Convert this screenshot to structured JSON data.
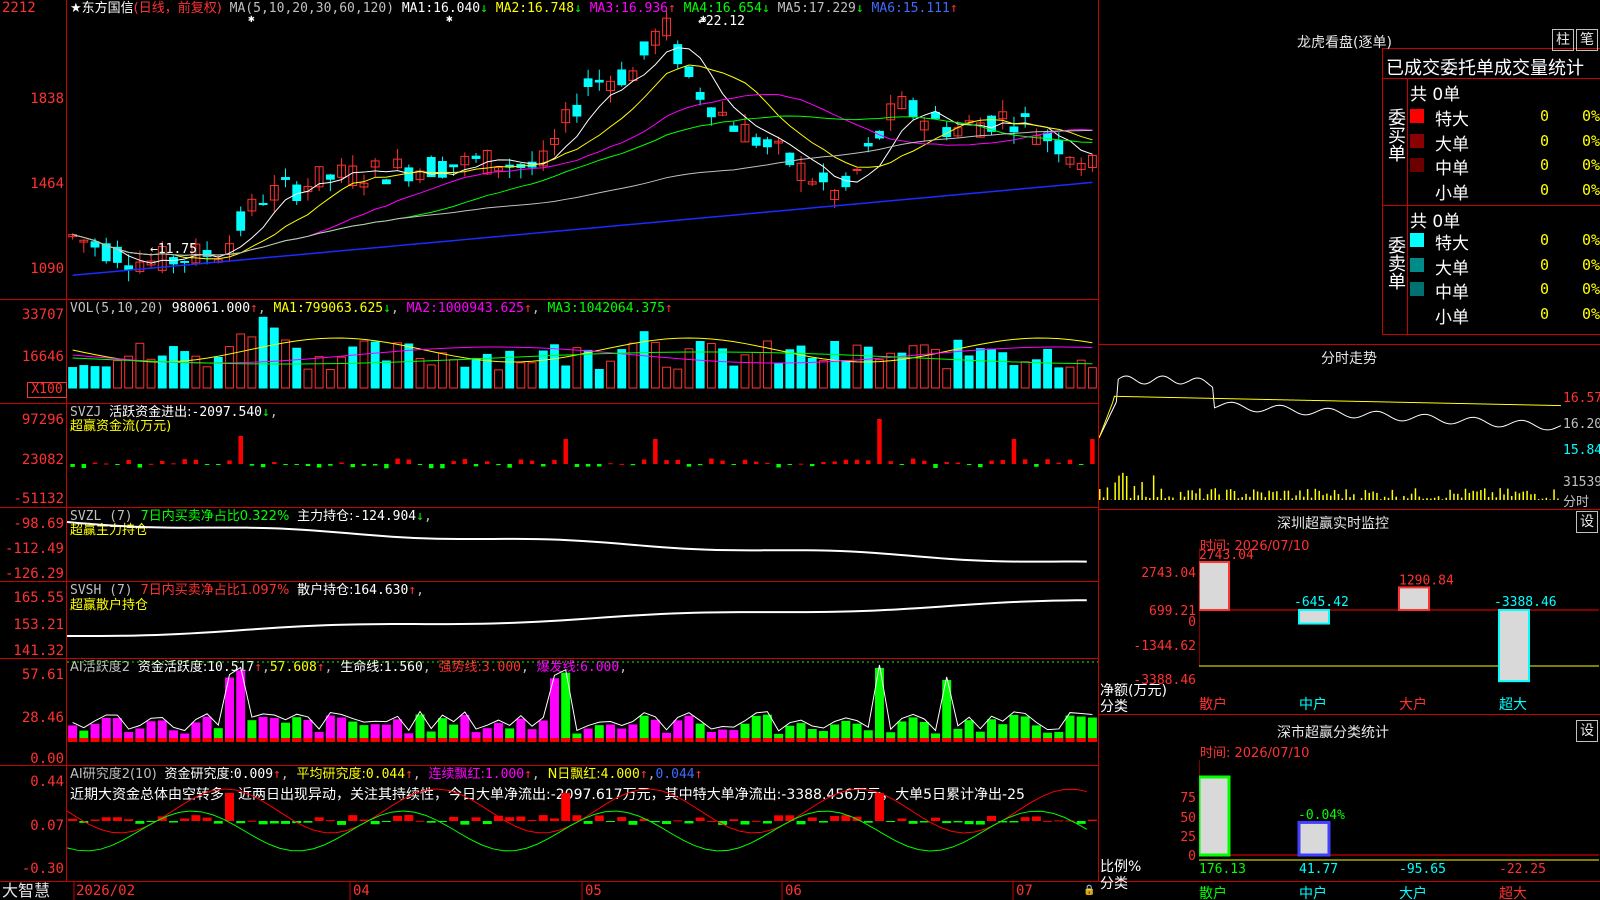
{
  "colors": {
    "up": "#ff3232",
    "down": "#00ffff",
    "bg": "#000000",
    "frame": "#c80000",
    "ma1": "#ffffff",
    "ma2": "#ffff00",
    "ma3": "#ff00ff",
    "ma4": "#00ff00",
    "ma5": "#c0c0c0",
    "ma6": "#1a2cff"
  },
  "brand": "大智慧",
  "main_chart": {
    "stock_name": "东方国信",
    "mode": "(日线，前复权)",
    "ma_label": "MA(5,10,20,30,60,120)",
    "ma1_label": "MA1:",
    "ma1_value": "16.040",
    "ma1_arrow": "↓",
    "ma2_label": "MA2:",
    "ma2_value": "16.748",
    "ma2_arrow": "↓",
    "ma3_label": "MA3:",
    "ma3_value": "16.936",
    "ma3_arrow": "↑",
    "ma4_label": "MA4:",
    "ma4_value": "16.654",
    "ma4_arrow": "↓",
    "ma5_label": "MA5:",
    "ma5_value": "17.229",
    "ma5_arrow": "↓",
    "ma6_label": "MA6:",
    "ma6_value": "15.111",
    "ma6_arrow": "↑",
    "y_ticks": [
      "2212",
      "1838",
      "1464",
      "1090"
    ],
    "high_mark": "22.12",
    "low_mark": "11.75",
    "x_labels": [
      "2026/02",
      "04",
      "05",
      "06",
      "07"
    ]
  },
  "vol": {
    "title": "VOL(5,10,20)",
    "value": "980061.000",
    "arrow": "↑",
    "ma1_label": "MA1:",
    "ma1_value": "799063.625",
    "ma1_arrow": "↓",
    "ma2_label": "MA2:",
    "ma2_value": "1000943.625",
    "ma2_arrow": "↑",
    "ma3_label": "MA3:",
    "ma3_value": "1042064.375",
    "ma3_arrow": "↑",
    "y_ticks": [
      "33707",
      "16646"
    ],
    "unit": "X100"
  },
  "svzj": {
    "title": "SVZJ",
    "label": "活跃资金进出:",
    "value": "-2097.540",
    "arrow": "↓",
    "sep": ",",
    "subtitle": "超赢资金流(万元)",
    "y_ticks": [
      "97296",
      "23082",
      "-51132"
    ]
  },
  "svzl": {
    "title": "SVZL (7)",
    "metric": "7日内买卖净占比0.322%",
    "label": "主力持仓:",
    "value": "-124.904",
    "arrow": "↓",
    "sep": ",",
    "subtitle": "超赢主力持仓",
    "y_ticks": [
      "-98.69",
      "-112.49",
      "-126.29"
    ]
  },
  "svsh": {
    "title": "SVSH (7)",
    "metric": "7日内买卖净占比1.097%",
    "label": "散户持仓:",
    "value": "164.630",
    "arrow": "↑",
    "sep": ",",
    "subtitle": "超赢散户持仓",
    "y_ticks": [
      "165.55",
      "153.21",
      "141.32"
    ]
  },
  "ai_active": {
    "title": "AI活跃度2",
    "label": "资金活跃度:",
    "value": "10.517",
    "arrow": "↑",
    "v2": "57.608",
    "v2_arrow": "↑",
    "life_label": "生命线:",
    "life_value": "1.560",
    "strong_label": "强势线:",
    "strong_value": "3.000",
    "burst_label": "爆发线:",
    "burst_value": "6.000",
    "y_ticks": [
      "57.61",
      "28.46",
      "0.00"
    ]
  },
  "ai_research": {
    "title": "AI研究度2(10)",
    "label": "资金研究度:",
    "value": "0.009",
    "arrow": "↑",
    "avg_label": "平均研究度:",
    "avg_value": "0.044",
    "avg_arrow": "↑",
    "cont_label": "连续飘红:",
    "cont_value": "1.000",
    "cont_arrow": "↑",
    "n_label": "N日飘红:",
    "n_value": "4.000",
    "n_arrow": "↑",
    "last_value": "0.044",
    "last_arrow": "↑",
    "comment": "近期大资金总体由空转多，近两日出现异动，关注其持续性，今日大单净流出:-2097.617万元，其中特大单净流出:-3388.456万元，大单5日累计净出-25",
    "y_ticks": [
      "0.44",
      "0.07",
      "-0.30"
    ]
  },
  "lhb": {
    "title": "龙虎看盘(逐单)",
    "btn1": "柱",
    "btn2": "笔",
    "tab": "已成交委托单成交量统计",
    "buy_label": "委买单",
    "sell_label": "委卖单",
    "buy_total": "共 0单",
    "sell_total": "共 0单",
    "buy_rows": [
      {
        "name": "特大",
        "count": "0",
        "pct": "0%",
        "color": "#ff0000"
      },
      {
        "name": "大单",
        "count": "0",
        "pct": "0%",
        "color": "#8b0000"
      },
      {
        "name": "中单",
        "count": "0",
        "pct": "0%",
        "color": "#6b0000"
      },
      {
        "name": "小单",
        "count": "0",
        "pct": "0%",
        "color": ""
      }
    ],
    "sell_rows": [
      {
        "name": "特大",
        "count": "0",
        "pct": "0%",
        "color": "#00ffff"
      },
      {
        "name": "大单",
        "count": "0",
        "pct": "0%",
        "color": "#008b8b"
      },
      {
        "name": "中单",
        "count": "0",
        "pct": "0%",
        "color": "#007070"
      },
      {
        "name": "小单",
        "count": "0",
        "pct": "0%",
        "color": ""
      }
    ]
  },
  "intraday": {
    "title": "分时走势",
    "y_ticks": [
      "16.57",
      "16.20",
      "15.84"
    ],
    "vol_tick": "31539",
    "vol_label": "分时"
  },
  "sz_monitor": {
    "title": "深圳超赢实时监控",
    "btn": "设",
    "date": "时间: 2026/07/10",
    "y_ticks": [
      "2743.04",
      "699.21",
      "0",
      "-1344.62",
      "-3388.46"
    ],
    "ylabel": "净额(万元)",
    "xlabel": "分类",
    "bars": [
      {
        "name": "散户",
        "value": "2743.04"
      },
      {
        "name": "中户",
        "value": "-645.42"
      },
      {
        "name": "大户",
        "value": "1290.84"
      },
      {
        "name": "超大",
        "value": "-3388.46"
      }
    ]
  },
  "sz_class": {
    "title": "深市超赢分类统计",
    "btn": "设",
    "date": "时间: 2026/07/10",
    "y_ticks": [
      "75",
      "50",
      "25",
      "0"
    ],
    "ylabel": "比例%",
    "xlabel": "分类",
    "mid_label": "-0.04%",
    "bars": [
      {
        "name": "散户",
        "value": "176.13"
      },
      {
        "name": "中户",
        "value": "41.77"
      },
      {
        "name": "大户",
        "value": "-95.65"
      },
      {
        "name": "超大",
        "value": "-22.25"
      }
    ]
  }
}
